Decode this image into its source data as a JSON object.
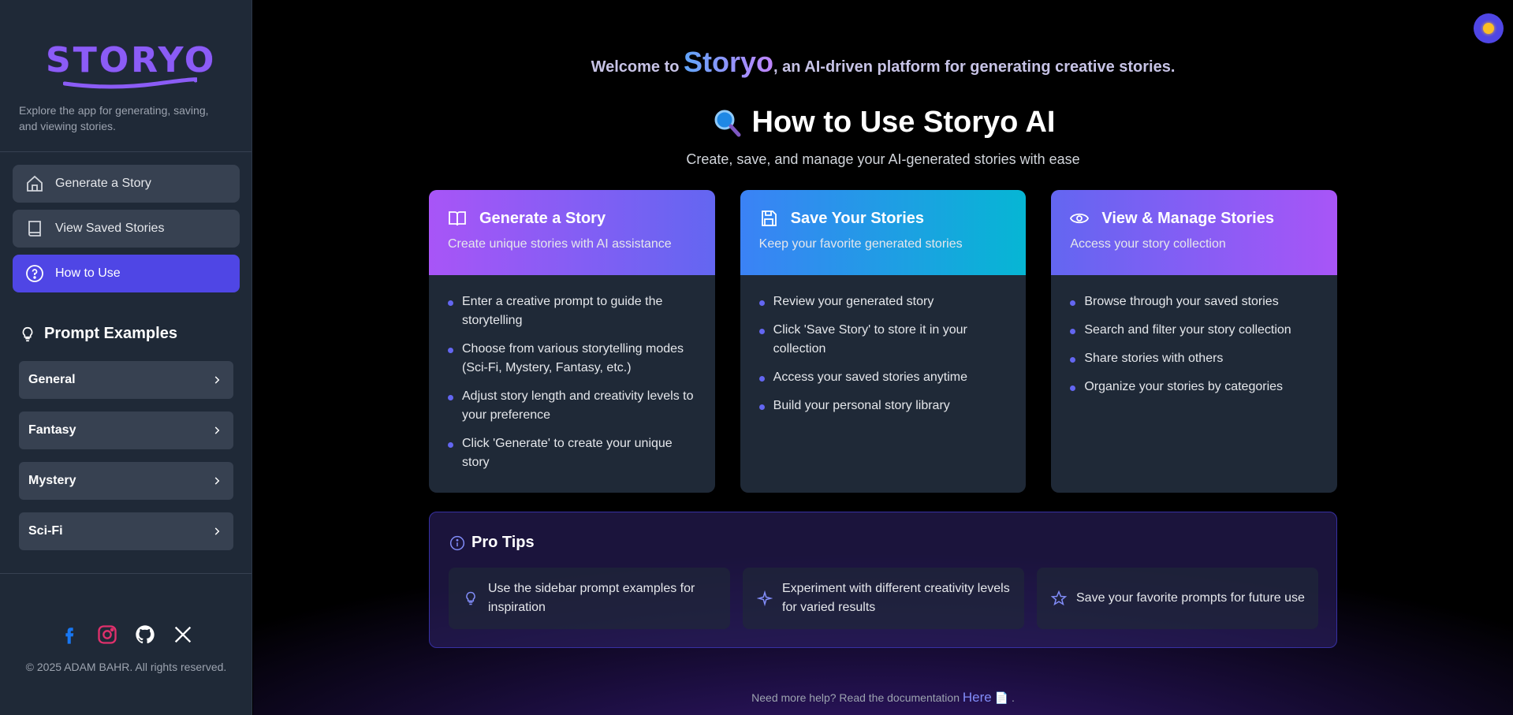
{
  "sidebar": {
    "logo_text": "STORYO",
    "tagline": "Explore the app for generating, saving, and viewing stories.",
    "nav": [
      {
        "label": "Generate a Story",
        "icon": "home-icon"
      },
      {
        "label": "View Saved Stories",
        "icon": "book-icon"
      },
      {
        "label": "How to Use",
        "icon": "help-circle-icon",
        "active": true
      }
    ],
    "prompt_examples_title": "Prompt Examples",
    "prompt_examples": [
      "General",
      "Fantasy",
      "Mystery",
      "Sci-Fi"
    ],
    "socials": [
      "facebook-icon",
      "instagram-icon",
      "github-icon",
      "x-icon"
    ],
    "copyright": "© 2025 ADAM BAHR. All rights reserved."
  },
  "main": {
    "welcome_prefix": "Welcome to",
    "welcome_brand": "Storyo",
    "welcome_suffix": ", an AI-driven platform for generating creative stories.",
    "title": "How to Use Storyo AI",
    "subtitle": "Create, save, and manage your AI-generated stories with ease",
    "cards": [
      {
        "title": "Generate a Story",
        "subtitle": "Create unique stories with AI assistance",
        "icon": "open-book-icon",
        "items": [
          "Enter a creative prompt to guide the storytelling",
          "Choose from various storytelling modes (Sci-Fi, Mystery, Fantasy, etc.)",
          "Adjust story length and creativity levels to your preference",
          "Click 'Generate' to create your unique story"
        ]
      },
      {
        "title": "Save Your Stories",
        "subtitle": "Keep your favorite generated stories",
        "icon": "save-icon",
        "items": [
          "Review your generated story",
          "Click 'Save Story' to store it in your collection",
          "Access your saved stories anytime",
          "Build your personal story library"
        ]
      },
      {
        "title": "View & Manage Stories",
        "subtitle": "Access your story collection",
        "icon": "eye-icon",
        "items": [
          "Browse through your saved stories",
          "Search and filter your story collection",
          "Share stories with others",
          "Organize your stories by categories"
        ]
      }
    ],
    "tips_title": "Pro Tips",
    "tips": [
      {
        "text": "Use the sidebar prompt examples for inspiration",
        "icon": "lightbulb-icon"
      },
      {
        "text": "Experiment with different creativity levels for varied results",
        "icon": "sparkle-icon"
      },
      {
        "text": "Save your favorite prompts for future use",
        "icon": "star-icon"
      }
    ],
    "help_text": "Need more help? Read the documentation",
    "help_link": "Here",
    "help_suffix": "."
  },
  "colors": {
    "accent": "#4f46e5",
    "sidebar_bg": "#1f2937",
    "brand_gradient_start": "#60a5fa",
    "brand_gradient_end": "#c084fc"
  }
}
